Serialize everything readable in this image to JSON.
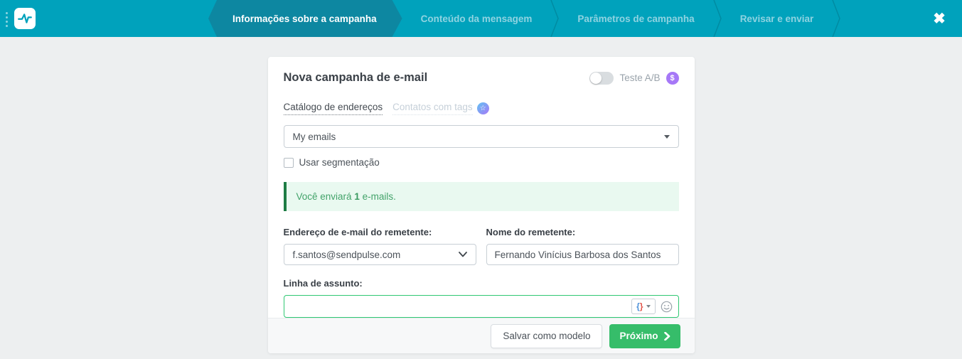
{
  "header": {
    "steps": [
      {
        "label": "Informações sobre a campanha",
        "active": true
      },
      {
        "label": "Conteúdo da mensagem",
        "active": false
      },
      {
        "label": "Parâmetros de campanha",
        "active": false
      },
      {
        "label": "Revisar e enviar",
        "active": false
      }
    ],
    "close_icon": "✖",
    "colors": {
      "bar": "#00a2bc",
      "active_step": "#0d87a1"
    }
  },
  "card": {
    "title": "Nova campanha de e-mail",
    "ab_test": {
      "label": "Teste A/B",
      "enabled": false,
      "paid_icon": "$"
    },
    "source_tabs": [
      {
        "label": "Catálogo de endereços",
        "active": true
      },
      {
        "label": "Contatos com tags",
        "active": false,
        "badge_icon": "☆"
      }
    ],
    "mailing_list": {
      "value": "My emails"
    },
    "segmentation": {
      "label": "Usar segmentação",
      "checked": false
    },
    "alert": {
      "prefix": "Você enviará",
      "count": "1",
      "suffix": "e-mails.",
      "accent": "#1d7c44"
    },
    "sender_email": {
      "label": "Endereço de e-mail do remetente:",
      "value": "f.santos@sendpulse.com"
    },
    "sender_name": {
      "label": "Nome do remetente:",
      "value": "Fernando Vinícius Barbosa dos Santos"
    },
    "subject": {
      "label": "Linha de assunto:",
      "value": "",
      "vars_open": "{",
      "vars_close": "}"
    },
    "footer": {
      "save_template": "Salvar como modelo",
      "next": "Próximo"
    }
  },
  "colors": {
    "green": "#36bd6a",
    "purple": "#a678f7",
    "page_bg": "#edeff0"
  }
}
